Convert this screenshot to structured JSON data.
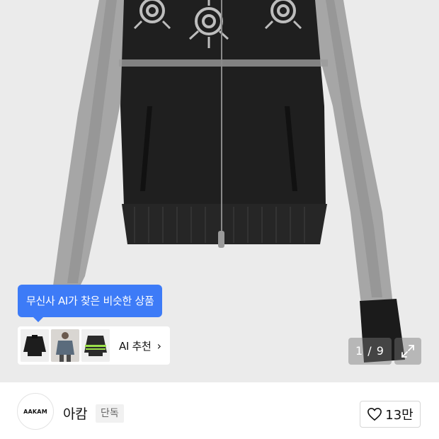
{
  "product_image": {
    "alt_icon": "knit-zip-cardigan-image"
  },
  "ai_recommend": {
    "tooltip_text": "무신사 AI가 찾은 비슷한 상품",
    "label": "AI 추천",
    "chevron": "›"
  },
  "gallery": {
    "pager_text": "1 / 9",
    "expand_icon": "expand-icon"
  },
  "brand": {
    "logo_text": "AAKAM",
    "name": "아캄",
    "badge": "단독"
  },
  "like": {
    "icon": "heart-outline-icon",
    "count": "13만"
  },
  "colors": {
    "tooltip_bg": "#3d7bf7",
    "hero_bg": "#ebebeb"
  }
}
